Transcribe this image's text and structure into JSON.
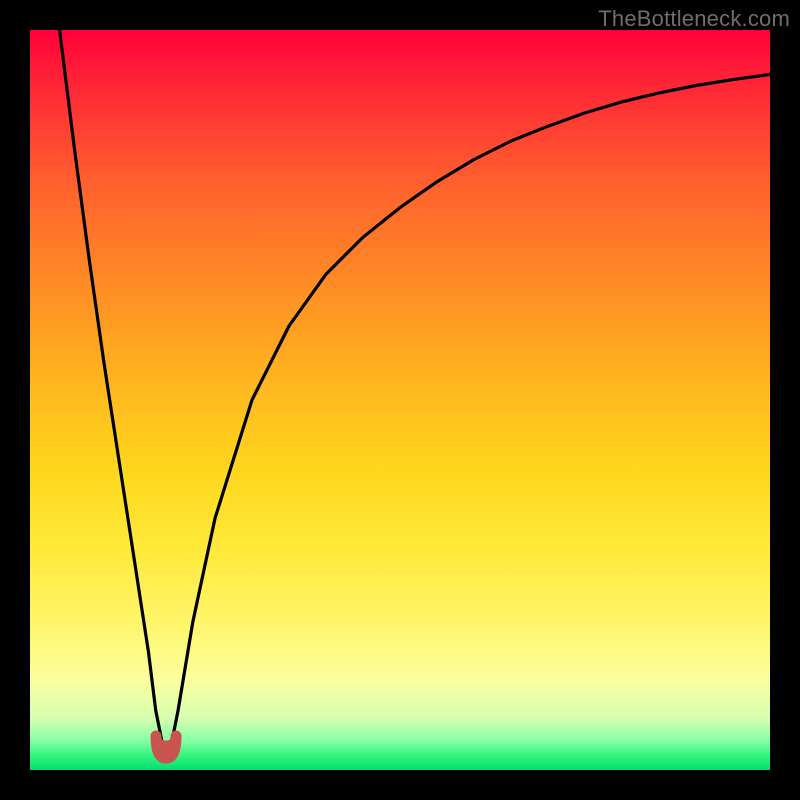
{
  "watermark": "TheBottleneck.com",
  "chart_data": {
    "type": "line",
    "title": "",
    "xlabel": "",
    "ylabel": "",
    "xlim": [
      0,
      100
    ],
    "ylim": [
      0,
      100
    ],
    "grid": false,
    "legend": false,
    "series": [
      {
        "name": "bottleneck-curve",
        "x": [
          4,
          6,
          8,
          10,
          12,
          14,
          16,
          17,
          18,
          19,
          20,
          22,
          25,
          30,
          35,
          40,
          45,
          50,
          55,
          60,
          65,
          70,
          75,
          80,
          85,
          90,
          95,
          100
        ],
        "values": [
          100,
          84,
          69,
          55,
          42,
          29,
          16,
          8,
          3,
          3,
          8,
          20,
          34,
          50,
          60,
          67,
          72,
          76,
          79.5,
          82.5,
          85,
          87,
          88.8,
          90.3,
          91.5,
          92.5,
          93.3,
          94
        ]
      }
    ],
    "marker": {
      "name": "optimal-point",
      "x": 18.5,
      "y": 2.5,
      "color": "#c9544f"
    },
    "gradient_stops": [
      {
        "pos": 0,
        "color": "#ff003a"
      },
      {
        "pos": 50,
        "color": "#ffbd1e"
      },
      {
        "pos": 88,
        "color": "#fbffa0"
      },
      {
        "pos": 100,
        "color": "#00e070"
      }
    ]
  }
}
